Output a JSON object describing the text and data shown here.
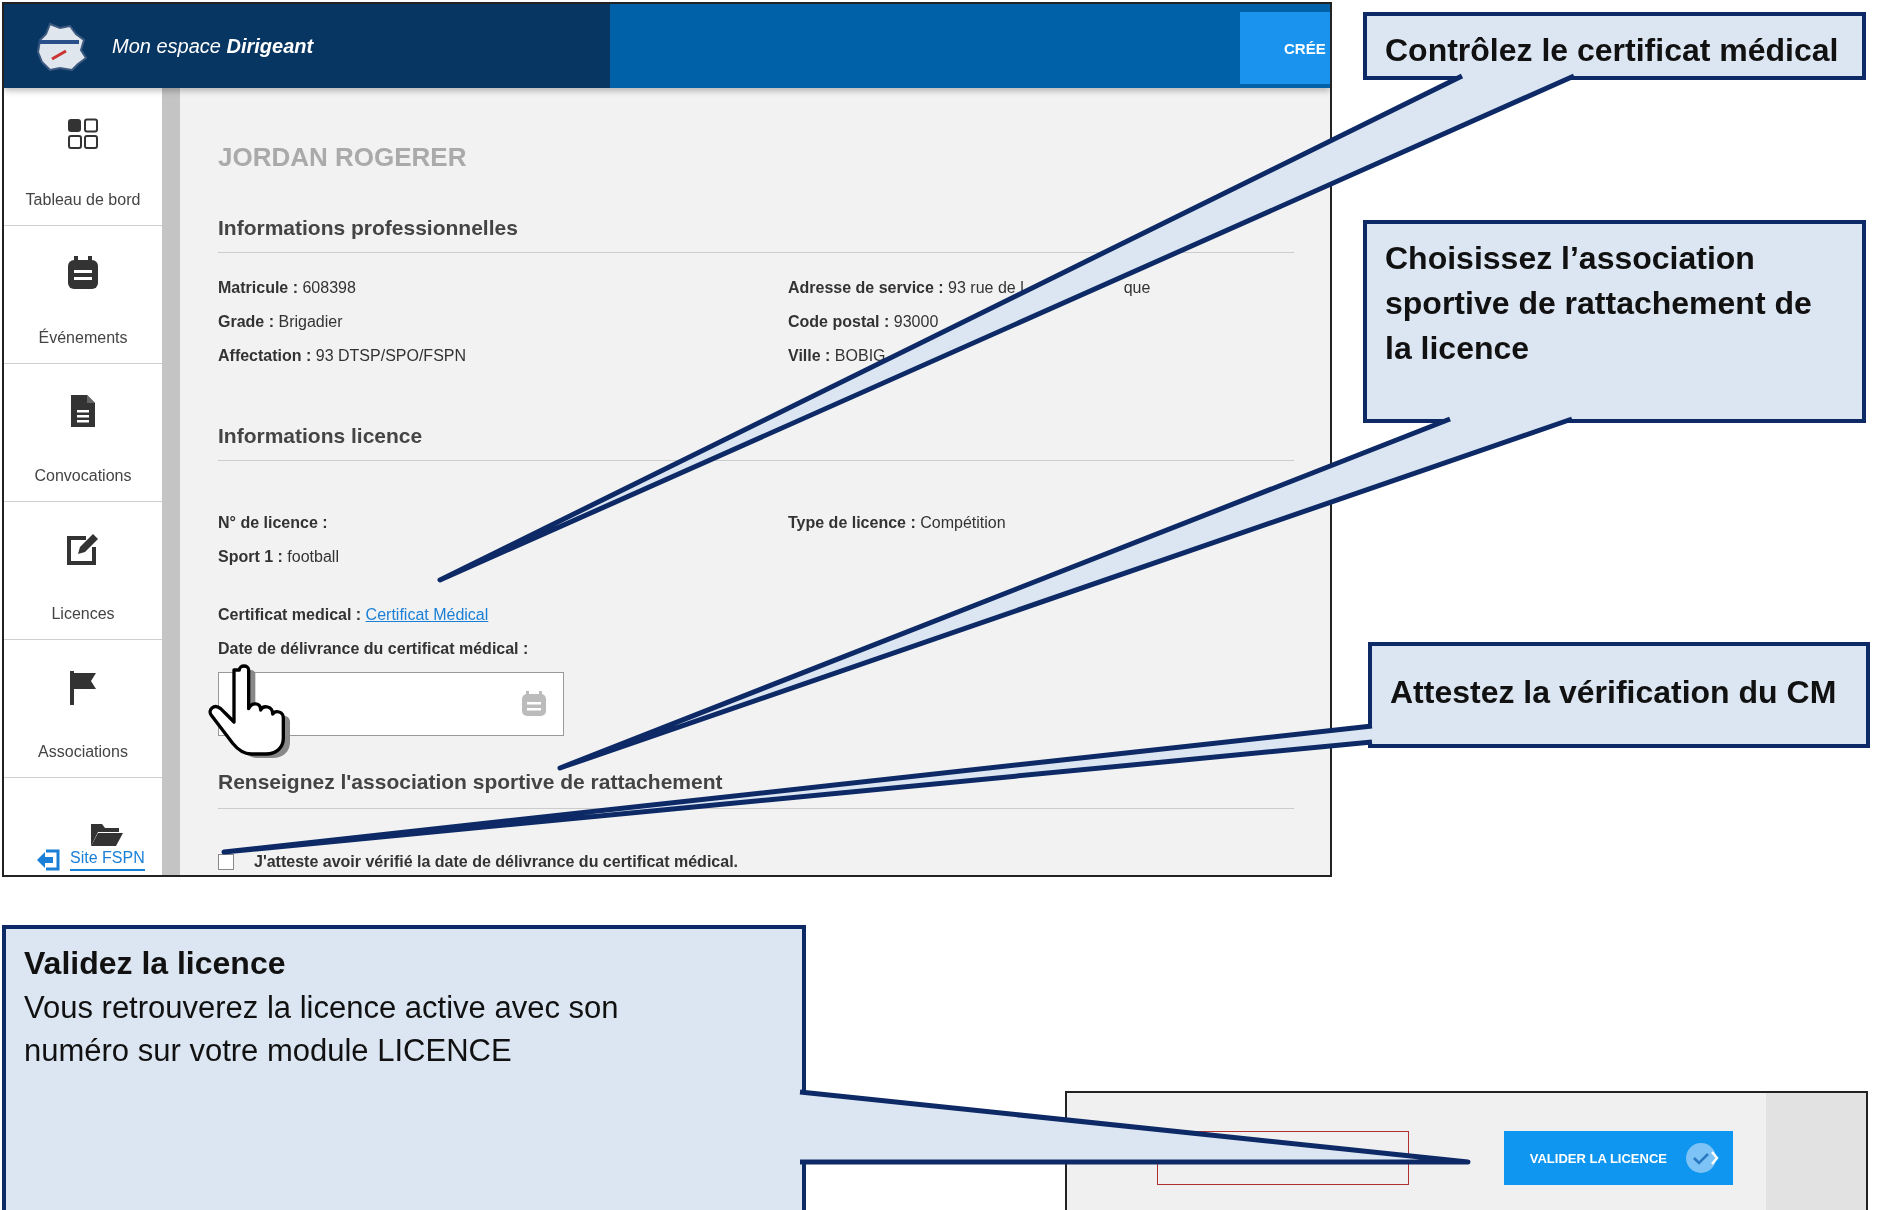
{
  "app_header": {
    "title": "Mon espace **Dirigeant**",
    "button": "CRÉE"
  },
  "sidebar": {
    "items": [
      {
        "kind": "dashboard",
        "label": "Tableau de bord"
      },
      {
        "kind": "calendar",
        "label": "Événements"
      },
      {
        "kind": "document",
        "label": "Convocations"
      },
      {
        "kind": "edit",
        "label": "Licences"
      },
      {
        "kind": "flag",
        "label": "Associations"
      }
    ],
    "footer_link": "Site FSPN"
  },
  "profile": {
    "name": "JORDAN ROGERER",
    "sections": [
      {
        "title": "Informations professionnelles",
        "fields": [
          {
            "label": "Matricule :",
            "value": "608398"
          },
          {
            "label": "Adresse de service :",
            "value": "93 rue de l",
            "value_tail": "que"
          },
          {
            "label": "Grade :",
            "value": "Brigadier"
          },
          {
            "label": "Code postal :",
            "value": "93000"
          },
          {
            "label": "Affectation :",
            "value": "93 DTSP/SPO/FSPN"
          },
          {
            "label": "Ville :",
            "value": "BOBIG"
          }
        ]
      },
      {
        "title": "Informations licence",
        "fields": [
          {
            "label": "N° de licence :"
          },
          {
            "label": "Type de licence :",
            "value": "Compétition"
          },
          {
            "label": "Sport 1 :",
            "value": "football"
          }
        ]
      }
    ],
    "certificate": {
      "label": "Certificat medical :",
      "link": "Certificat Médical"
    },
    "date_field": {
      "label": "Date de délivrance du certificat médical :"
    },
    "association_title": "Renseignez l'association sportive de rattachement",
    "attest": {
      "label": "J'atteste avoir vérifié la date de délivrance du certificat médical.",
      "checked": false
    }
  },
  "validate_button": "VALIDER LA LICENCE",
  "callouts": [
    {
      "title": "Contrôlez le certificat médical"
    },
    {
      "title": "Choisissez l’association sportive de rattachement de la licence"
    },
    {
      "title": "Attestez la vérification du CM"
    },
    {
      "title": "Validez la licence",
      "text": "Vous retrouverez la licence active avec son numéro sur votre module LICENCE"
    }
  ]
}
